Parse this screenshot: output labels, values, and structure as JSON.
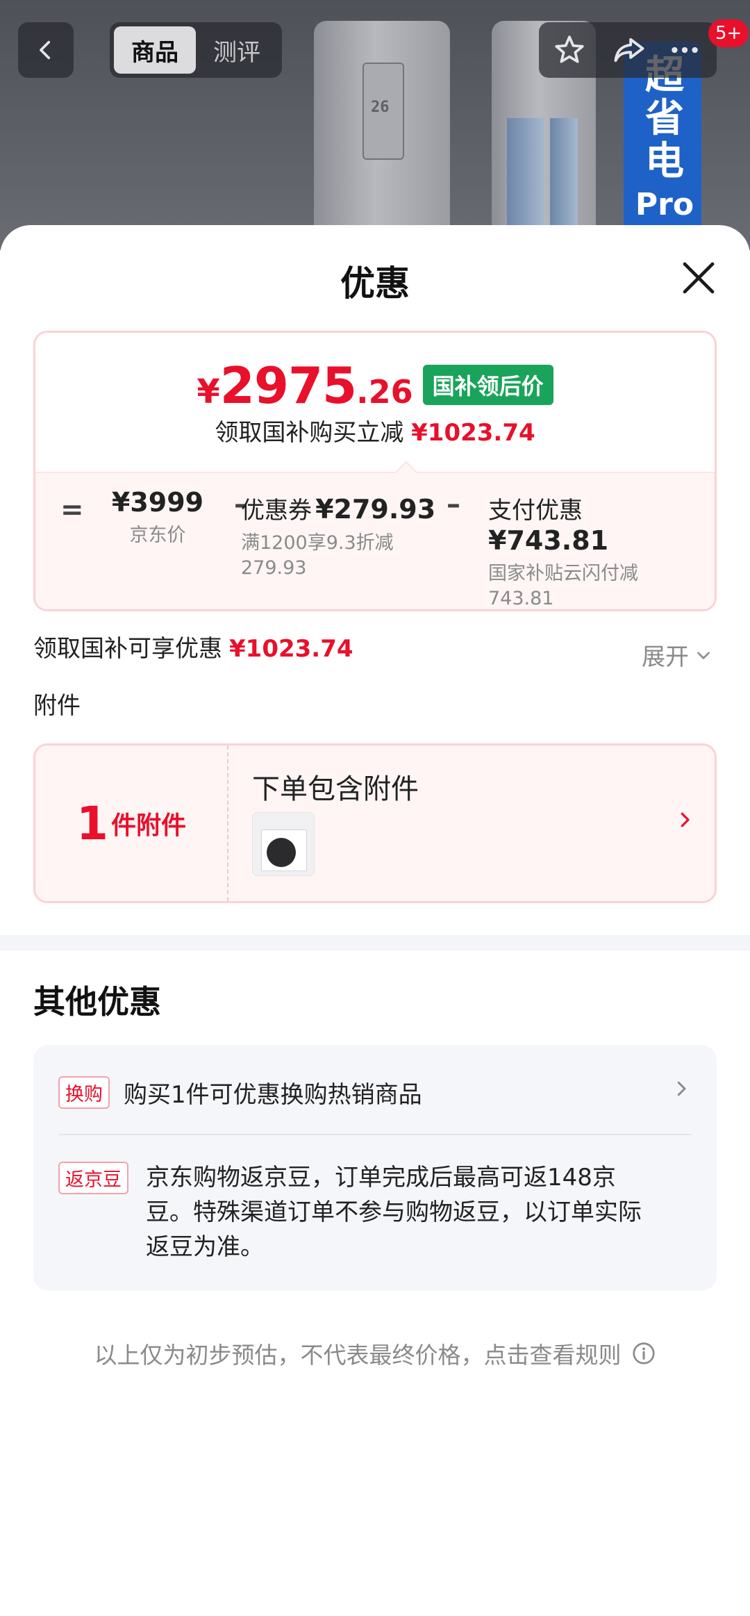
{
  "header": {
    "tabs": [
      {
        "label": "商品",
        "active": true
      },
      {
        "label": "测评",
        "active": false
      }
    ],
    "badge": "5+",
    "product_image": {
      "display_reading": "26",
      "banner_text": [
        "超",
        "省",
        "电",
        "Pro"
      ]
    }
  },
  "sheet": {
    "title": "优惠",
    "price_card": {
      "final_price": {
        "currency": "¥",
        "integer": "2975",
        "decimal": ".26"
      },
      "tag": "国补领后价",
      "reduce_text": "领取国补购买立减",
      "reduce_amount": "¥1023.74",
      "calc": {
        "equals": "=",
        "base": {
          "value": "¥3999",
          "label": "京东价"
        },
        "minus": "–",
        "coupon": {
          "label": "优惠券",
          "value": "¥279.93",
          "detail": "满1200享9.3折减279.93"
        },
        "payment": {
          "label": "支付优惠",
          "value": "¥743.81",
          "detail": "国家补贴云闪付减743.81"
        }
      }
    },
    "summary": {
      "label": "领取国补可享优惠",
      "amount": "¥1023.74",
      "expand_label": "展开"
    },
    "accessory": {
      "section_label": "附件",
      "count": "1",
      "count_unit": "件附件",
      "title": "下单包含附件"
    },
    "other": {
      "title": "其他优惠",
      "items": [
        {
          "tag": "换购",
          "text": "购买1件可优惠换购热销商品"
        },
        {
          "tag": "返京豆",
          "text": "京东购物返京豆，订单完成后最高可返148京豆。特殊渠道订单不参与购物返豆，以订单实际返豆为准。"
        }
      ]
    },
    "disclaimer": "以上仅为初步预估，不代表最终价格，点击查看规则"
  },
  "colors": {
    "accent_red": "#e8102b",
    "tag_green": "#1aa35a",
    "card_pink": "#fff5f5"
  }
}
